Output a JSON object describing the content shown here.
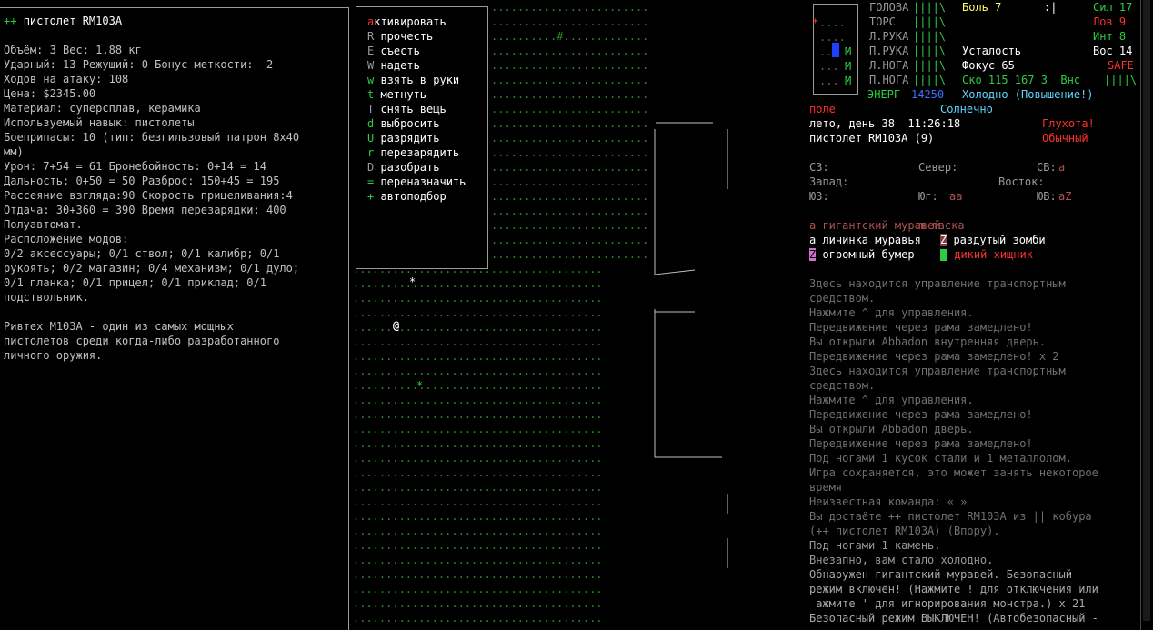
{
  "item": {
    "title_prefix": "++",
    "title": "пистолет RM103A",
    "lines": [
      "",
      "Объём: 3 Вес: 1.88 кг",
      "Ударный: 13 Режущий: 0 Бонус меткости: -2",
      "Ходов на атаку: 108",
      "Цена: $2345.00",
      "Материал: суперсплав, керамика",
      "Используемый навык: пистолеты",
      "Боеприпасы: 10 (тип: безгильзовый патрон 8x40",
      "мм)",
      "Урон: 7+54 = 61 Бронебойность: 0+14 = 14",
      "Дальность: 0+50 = 50 Разброс: 150+45 = 195",
      "Рассеяние взгляда:90 Скорость прицеливания:4",
      "Отдача: 30+360 = 390 Время перезарядки: 400",
      "Полуавтомат.",
      "Расположение модов:",
      "0/2 аксессуары; 0/1 ствол; 0/1 калибр; 0/1",
      "рукоять; 0/2 магазин; 0/4 механизм; 0/1 дуло;",
      "0/1 планка; 0/1 прицел; 0/1 приклад; 0/1",
      "подствольник.",
      "",
      "Ривтех M103A - один из самых мощных",
      "пистолетов среди когда-либо разработанного",
      "личного оружия."
    ]
  },
  "menu": [
    {
      "key": "a",
      "label": "ктивировать"
    },
    {
      "key": "R",
      "label": "прочесть"
    },
    {
      "key": "E",
      "label": "съесть"
    },
    {
      "key": "W",
      "label": "надеть"
    },
    {
      "key": "w",
      "label": "взять в руки"
    },
    {
      "key": "t",
      "label": "метнуть"
    },
    {
      "key": "T",
      "label": "снять вещь"
    },
    {
      "key": "d",
      "label": "выбросить"
    },
    {
      "key": "U",
      "label": "разрядить"
    },
    {
      "key": "r",
      "label": "перезарядить"
    },
    {
      "key": "D",
      "label": "разобрать"
    },
    {
      "key": "=",
      "label": "переназначить"
    },
    {
      "key": "+",
      "label": "автоподбор"
    }
  ],
  "status": {
    "body_parts": [
      "ГОЛОВА",
      "ТОРС",
      "Л.РУКА",
      "П.РУКА",
      "Л.НОГА",
      "П.НОГА"
    ],
    "health_bars": [
      "||||\\",
      "||||\\",
      "||||\\",
      "||||\\",
      "||||\\",
      "||||\\"
    ],
    "pain": "Боль 7",
    "pain_mark": ":|",
    "fatigue": "Усталость",
    "focus": "Фокус 65",
    "speed_line": "Ско 115 167 3  Внс",
    "speed_bar": "||||\\",
    "energy_label": "ЭНЕРГ",
    "energy_value": "14250",
    "temperature": "Холодно (Повышение!)",
    "stats": [
      {
        "label": "Сил",
        "value": "17"
      },
      {
        "label": "Лов",
        "value": "9"
      },
      {
        "label": "Инт",
        "value": "8"
      },
      {
        "label": "Вос",
        "value": "14"
      }
    ],
    "safe": "SAFE",
    "location": "поле",
    "weather": "Солнечно",
    "date_time": "лето, день 38  11:26:18",
    "deafness": "Глухота!",
    "weapon": "пистолет RM103A (9)",
    "stance": "Обычный"
  },
  "compass": {
    "nw": "СЗ:",
    "n": "Север:",
    "ne": "СВ:",
    "ne_mark": "a",
    "w": "Запад:",
    "e": "Восток:",
    "sw": "ЮЗ:",
    "s": "Юг:",
    "s_marks": "aa",
    "se": "ЮВ:",
    "se_marks": "aZ"
  },
  "monsters": [
    {
      "sym": "a",
      "name": "гигантский муравей",
      "color": "#b05050"
    },
    {
      "sym": "m",
      "name": "ласка",
      "color": "#b05050"
    },
    {
      "sym": "a",
      "name": "личинка муравья",
      "color": "#ffffff"
    },
    {
      "sym": "Z",
      "name": "раздутый зомби",
      "color": "#ffffff"
    },
    {
      "sym": "Z",
      "name": "огромный бумер",
      "color": "#ffffff"
    },
    {
      "sym": "",
      "name": "дикий хищник",
      "color": "#ff3030"
    }
  ],
  "log": [
    "Здесь находится управление транспортным",
    "средством.",
    "Нажмите ^ для управления.",
    "Передвижение через рама замедлено!",
    "Вы открыли Abbadon внутренняя дверь.",
    "Передвижение через рама замедлено! x 2",
    "Здесь находится управление транспортным",
    "средством.",
    "Нажмите ^ для управления.",
    "Передвижение через рама замедлено!",
    "Вы открыли Abbadon дверь.",
    "Передвижение через рама замедлено!",
    "Под ногами 1 кусок стали и 1 металлолом.",
    "Игра сохраняется, это может занять некоторое",
    "время",
    "Неизвестная команда: « »",
    "Вы достаёте ++ пистолет RM103A из || кобура",
    "(++ пистолет RM103A) (Впору).",
    "Под ногами 1 камень.",
    "Внезапно, вам стало холодно.",
    "Обнаружен гигантский муравей. Безопасный",
    "режим включён! (Нажмите ! для отключения или",
    " ажмите ' для игнорирования монстра.) x 21",
    "Безопасный режим ВЫКЛЮЧЕН! (Автобезопасный -"
  ],
  "map_rows": [
    ".............................................",
    ".........................................",
    "..........#..............................",
    ".............................................",
    "..........................................",
    "........................................",
    ".......................................",
    "..........................................",
    "..........................................",
    "........................................",
    "......................................",
    "..........................................",
    "......................................",
    "......................................",
    "......................................",
    "......................................",
    "......................................",
    "......................................",
    "......................................",
    "......................................",
    "......................................",
    "......................................",
    "......................................",
    "......................................",
    "......................................",
    "......................................",
    "......................................",
    "......................................",
    "......................................",
    "......................................",
    "......................................",
    "......................................",
    "......................................",
    "......................................",
    "......................................",
    "......................................",
    "......................................",
    "......................................",
    "......................................",
    "......................................",
    "......................................",
    "......................................",
    "......................................"
  ]
}
